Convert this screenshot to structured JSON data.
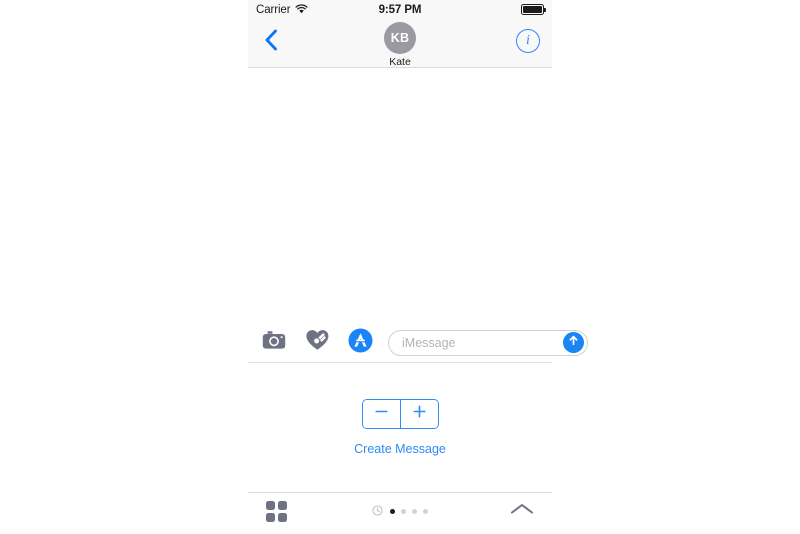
{
  "status_bar": {
    "carrier": "Carrier",
    "wifi_icon": "wifi-icon",
    "time": "9:57 PM",
    "battery_icon": "battery-full-icon",
    "battery_level_percent": 100
  },
  "nav_bar": {
    "back_icon": "chevron-left-icon",
    "info_icon": "info-circle-icon",
    "info_label": "i",
    "contact": {
      "initials": "KB",
      "name": "Kate",
      "avatar_color": "#9a9aa2"
    }
  },
  "input_bar": {
    "icons": [
      {
        "name": "camera-icon",
        "label": "Camera"
      },
      {
        "name": "digital-touch-heart-icon",
        "label": "Digital Touch"
      },
      {
        "name": "app-store-icon",
        "label": "App Store"
      }
    ],
    "message_input": {
      "placeholder": "iMessage",
      "value": ""
    },
    "send_icon": "send-arrow-up-icon"
  },
  "app_panel": {
    "stepper": {
      "minus_label": "−",
      "plus_label": "+",
      "minus_icon": "minus-icon",
      "plus_icon": "plus-icon"
    },
    "create_message_label": "Create Message"
  },
  "app_drawer_bar": {
    "grid_icon": "app-grid-icon",
    "recents_icon": "recents-clock-icon",
    "pages": 4,
    "active_page": 1,
    "expand_icon": "chevron-up-icon"
  },
  "colors": {
    "accent_blue": "#2e8bf7",
    "send_blue": "#1a85f5",
    "bar_background": "#F8F8F8",
    "gray_icon": "#6e7282",
    "placeholder_gray": "#b3b3b8"
  }
}
